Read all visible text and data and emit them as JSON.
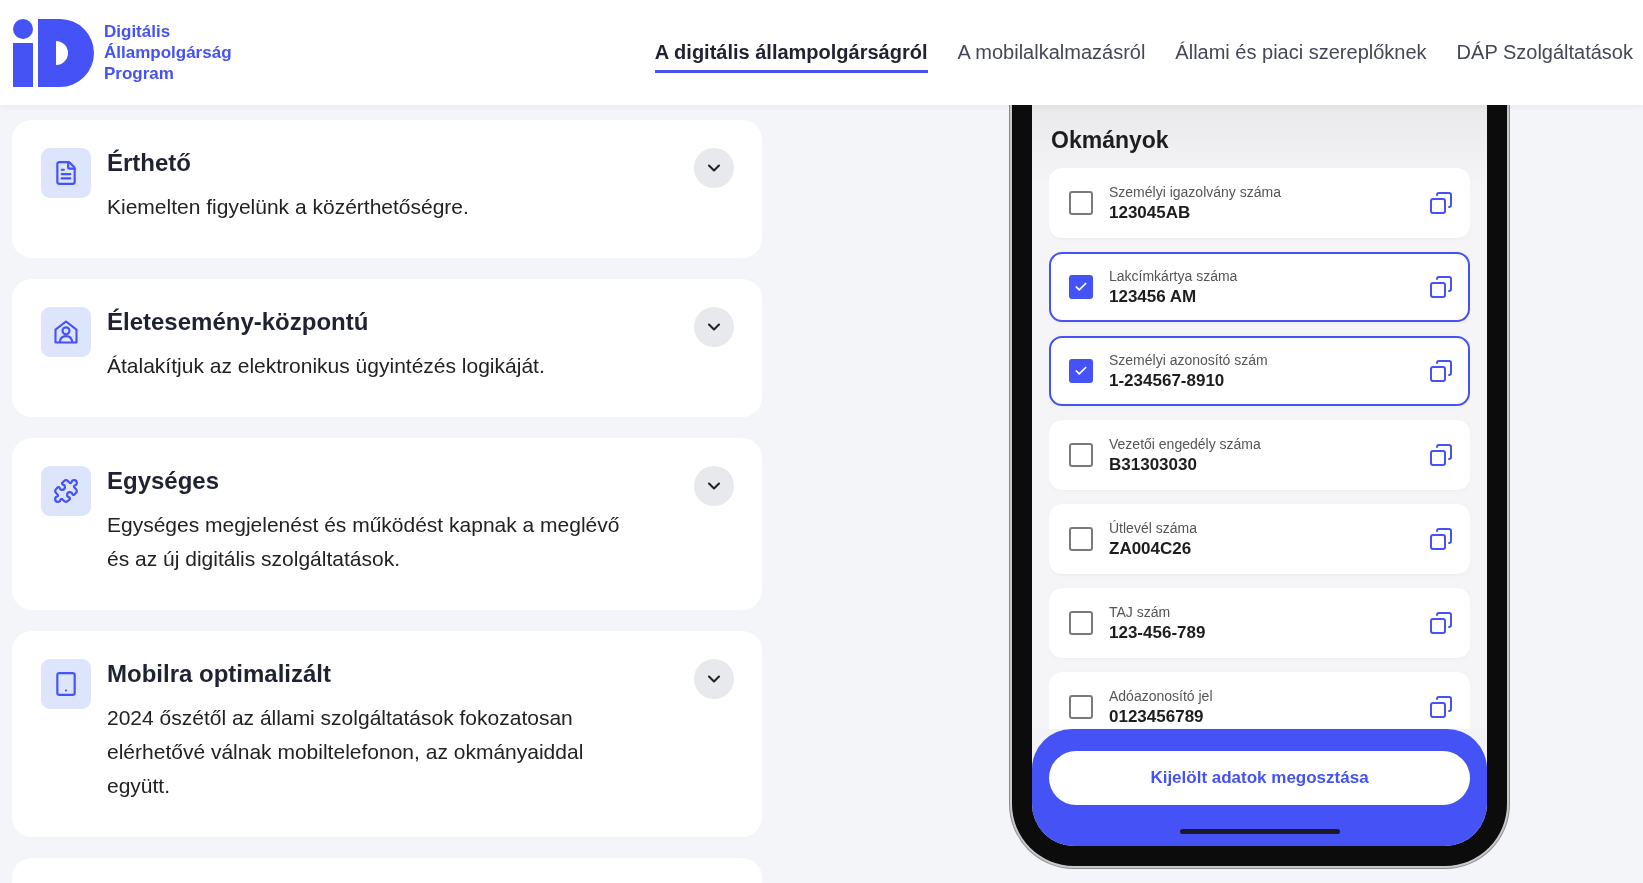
{
  "header": {
    "logo_lines": [
      "Digitális",
      "Állampolgárság",
      "Program"
    ],
    "nav": [
      {
        "label": "A digitális állampolgárságról",
        "selected": true
      },
      {
        "label": "A mobilalkalmazásról",
        "selected": false
      },
      {
        "label": "Állami és piaci szereplőknek",
        "selected": false
      },
      {
        "label": "DÁP Szolgáltatások",
        "selected": false
      }
    ]
  },
  "features": [
    {
      "kind": "document",
      "title": "Érthető",
      "text": "Kiemelten figyelünk a közérthetőségre."
    },
    {
      "kind": "home",
      "title": "Életesemény-központú",
      "text": "Átalakítjuk az elektronikus ügyintézés logikáját."
    },
    {
      "kind": "puzzle",
      "title": "Egységes",
      "text": "Egységes megjelenést és működést kapnak a meglévő és az új digitális szolgáltatások."
    },
    {
      "kind": "mobile",
      "title": "Mobilra optimalizált",
      "text": "2024 őszétől az állami szolgáltatások fokozatosan elérhetővé válnak mobiltelefonon, az okmányaiddal együtt."
    }
  ],
  "phone": {
    "title": "Okmányok",
    "documents": [
      {
        "label": "Személyi igazolvány száma",
        "value": "123045AB",
        "checked": false
      },
      {
        "label": "Lakcímkártya száma",
        "value": "123456 AM",
        "checked": true
      },
      {
        "label": "Személyi azonosító szám",
        "value": "1-234567-8910",
        "checked": true
      },
      {
        "label": "Vezetői engedély száma",
        "value": "B31303030",
        "checked": false
      },
      {
        "label": "Útlevél száma",
        "value": "ZA004C26",
        "checked": false
      },
      {
        "label": "TAJ szám",
        "value": "123-456-789",
        "checked": false
      },
      {
        "label": "Adóazonosító jel",
        "value": "0123456789",
        "checked": false
      }
    ],
    "share_button": "Kijelölt adatok megosztása"
  }
}
